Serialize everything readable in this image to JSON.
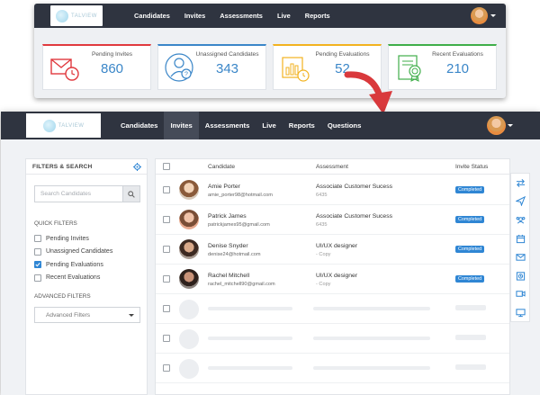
{
  "back_app": {
    "nav": [
      "Candidates",
      "Invites",
      "Assessments",
      "Live",
      "Reports"
    ],
    "stats": [
      {
        "label": "Pending Invites",
        "value": "860",
        "accent": "#e0393e",
        "icon": "envelope-clock-icon"
      },
      {
        "label": "Unassigned Candidates",
        "value": "343",
        "accent": "#3a86c8",
        "icon": "person-question-icon"
      },
      {
        "label": "Pending Evaluations",
        "value": "52",
        "accent": "#f2b21f",
        "icon": "chart-clock-icon"
      },
      {
        "label": "Recent Evaluations",
        "value": "210",
        "accent": "#3fae49",
        "icon": "certificate-icon"
      }
    ]
  },
  "front_app": {
    "nav": [
      "Candidates",
      "Invites",
      "Assessments",
      "Live",
      "Reports",
      "Questions"
    ],
    "active_nav": "Invites",
    "sidebar": {
      "title": "FILTERS & SEARCH",
      "search_placeholder": "Search Candidates",
      "quick_filters_label": "QUICK FILTERS",
      "quick_filters": [
        {
          "label": "Pending Invites",
          "checked": false
        },
        {
          "label": "Unassigned Candidates",
          "checked": false
        },
        {
          "label": "Pending Evaluations",
          "checked": true
        },
        {
          "label": "Recent Evaluations",
          "checked": false
        }
      ],
      "advanced_label": "ADVANCED FILTERS",
      "advanced_select": "Advanced Filters"
    },
    "table": {
      "headers": [
        "Candidate",
        "Assessment",
        "Invite Status"
      ],
      "rows": [
        {
          "name": "Amie Porter",
          "email": "amie_porter98@hotmail.com",
          "assessment": "Associate Customer Sucess",
          "code": "6435",
          "status": "Completed"
        },
        {
          "name": "Patrick James",
          "email": "patrickjames95@gmail.com",
          "assessment": "Associate Customer Sucess",
          "code": "6435",
          "status": "Completed"
        },
        {
          "name": "Denise Snyder",
          "email": "denise24@hotmail.com",
          "assessment": "UI/UX designer",
          "code": "- Copy",
          "status": "Completed"
        },
        {
          "name": "Rachel Mitchell",
          "email": "rachel_mitchell90@gmail.com",
          "assessment": "UI/UX designer",
          "code": "- Copy",
          "status": "Completed"
        }
      ]
    },
    "rail_icons": [
      "swap-icon",
      "send-icon",
      "team-icon",
      "calendar-icon",
      "mail-icon",
      "alarm-icon",
      "video-icon",
      "monitor-icon"
    ]
  },
  "colors": {
    "nav_bg": "#2f3440",
    "accent_blue": "#2f86d4",
    "arrow_red": "#d9393c"
  }
}
